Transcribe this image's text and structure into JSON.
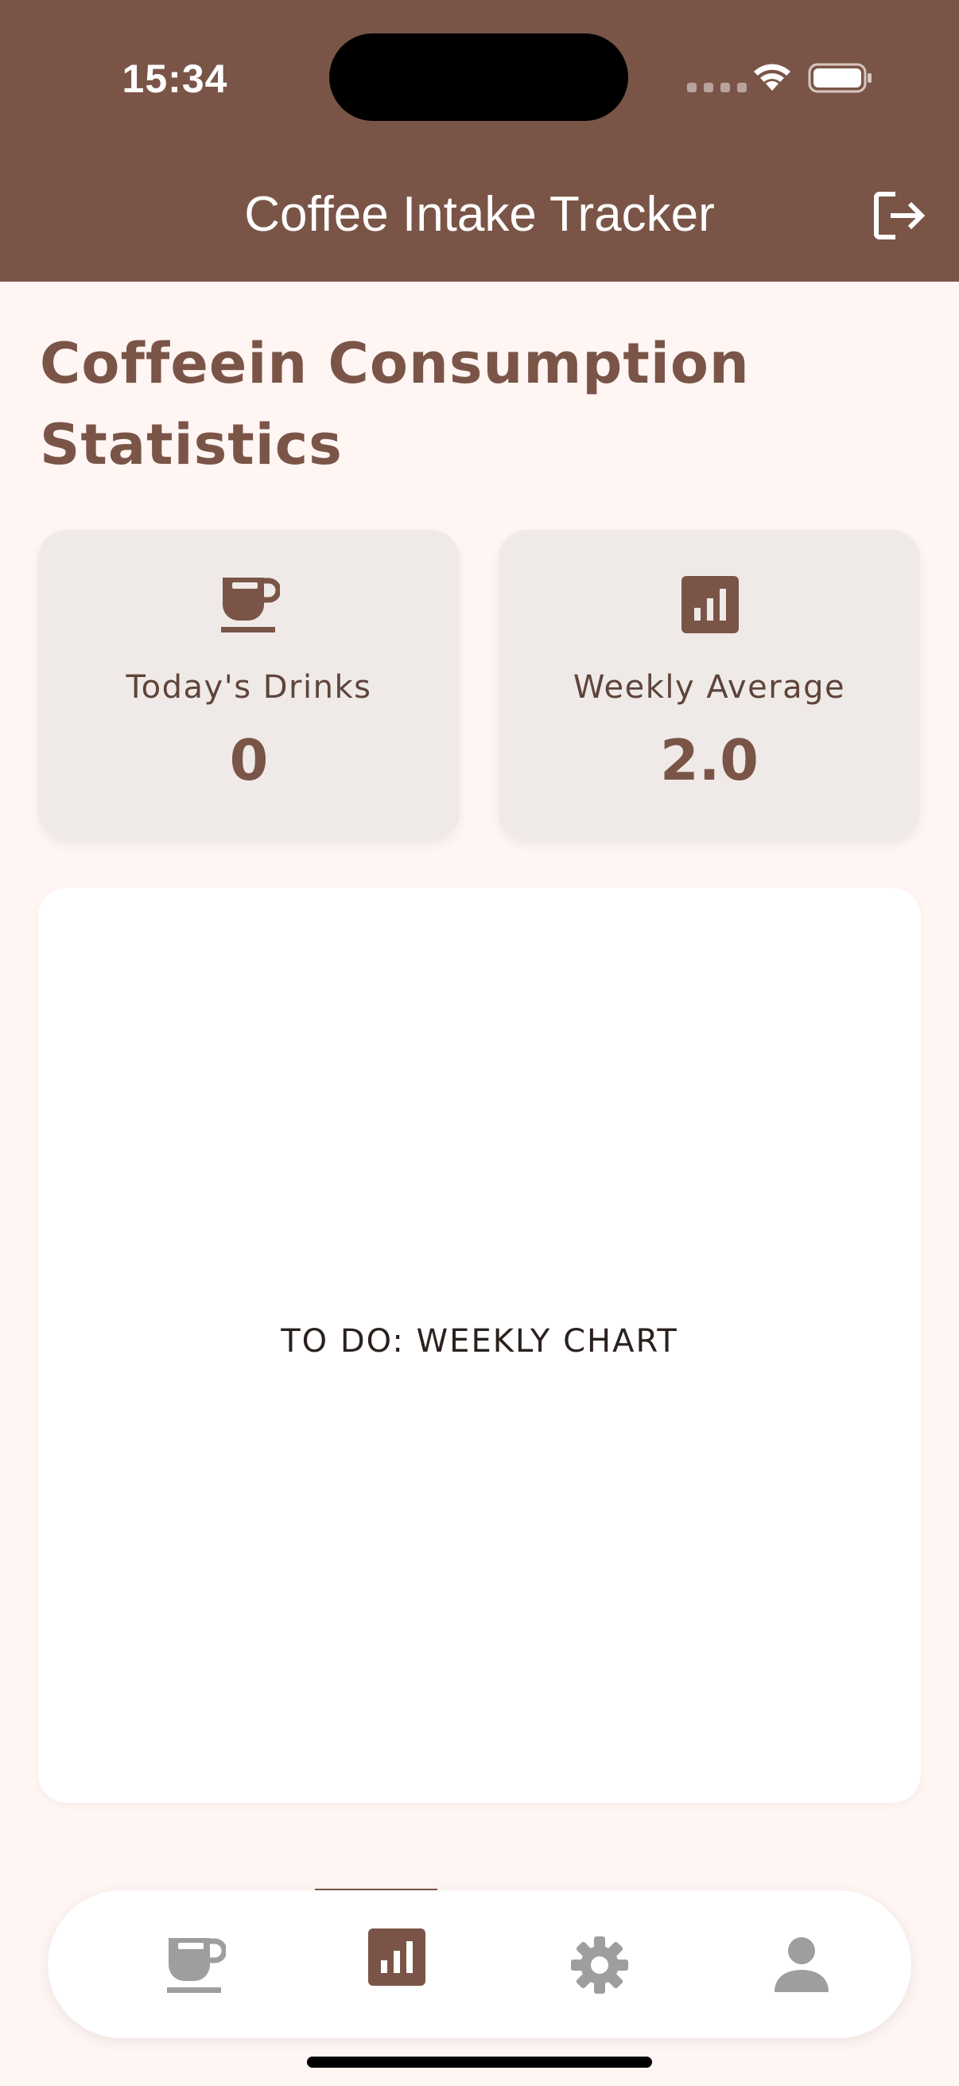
{
  "status_bar": {
    "time": "15:34"
  },
  "app_bar": {
    "title": "Coffee Intake Tracker",
    "logout_icon": "logout-icon"
  },
  "page": {
    "title": "Coffeein Consumption Statistics"
  },
  "stats": [
    {
      "icon": "coffee-cup-icon",
      "label": "Today's Drinks",
      "value": "0"
    },
    {
      "icon": "bar-chart-icon",
      "label": "Weekly Average",
      "value": "2.0"
    }
  ],
  "chart_placeholder": {
    "text": "TO DO: WEEKLY CHART"
  },
  "bottom_nav": {
    "items": [
      {
        "icon": "coffee-cup-icon",
        "active": false
      },
      {
        "icon": "bar-chart-icon",
        "active": true
      },
      {
        "icon": "gear-icon",
        "active": false
      },
      {
        "icon": "person-icon",
        "active": false
      }
    ]
  },
  "colors": {
    "primary": "#7A5547",
    "background": "#FFF5F3",
    "card": "#EFEAE7",
    "inactive_icon": "#9E9E9E"
  }
}
